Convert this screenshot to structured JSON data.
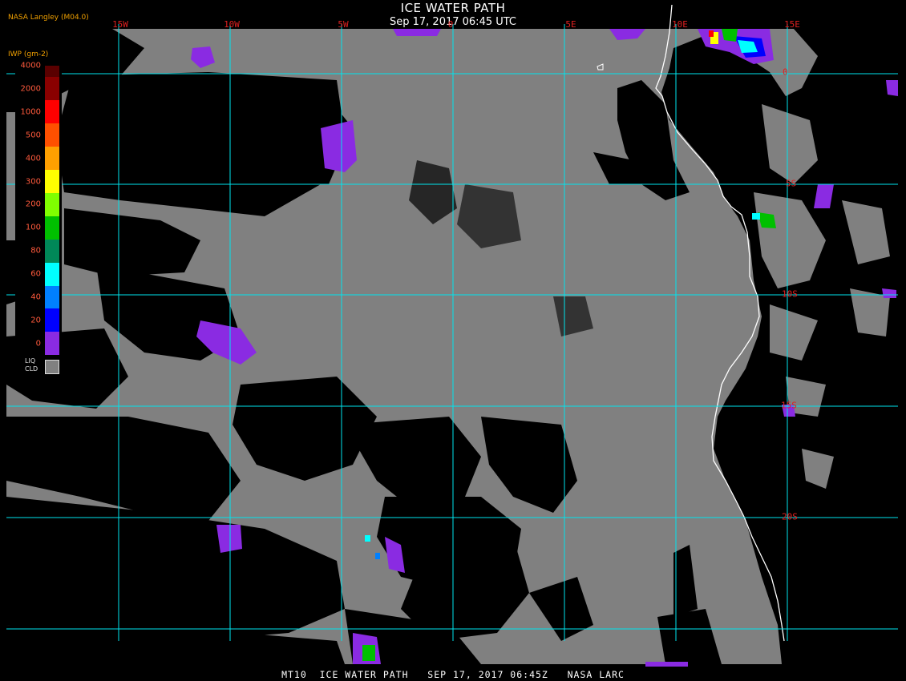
{
  "header": {
    "title": "ICE WATER PATH",
    "subtitle": "Sep 17, 2017 06:45 UTC",
    "brand": "NASA Langley (M04.0)"
  },
  "footer": {
    "text": "MT10  ICE WATER PATH   SEP 17, 2017 06:45Z   NASA LARC"
  },
  "grid": {
    "longitude_labels": [
      "15W",
      "10W",
      "5W",
      "0",
      "5E",
      "10E",
      "15E"
    ],
    "latitude_labels": [
      "0",
      "5S",
      "10S",
      "15S",
      "20S"
    ]
  },
  "legend": {
    "title": "IWP (gm-2)",
    "entries": [
      {
        "label": "4000",
        "color": "#5a0000"
      },
      {
        "label": "2000",
        "color": "#8a0000"
      },
      {
        "label": "1000",
        "color": "#ff0000"
      },
      {
        "label": "500",
        "color": "#ff5000"
      },
      {
        "label": "400",
        "color": "#ffa000"
      },
      {
        "label": "300",
        "color": "#ffff00"
      },
      {
        "label": "200",
        "color": "#80ff00"
      },
      {
        "label": "100",
        "color": "#00c000"
      },
      {
        "label": "80",
        "color": "#008858"
      },
      {
        "label": "60",
        "color": "#00ffff"
      },
      {
        "label": "40",
        "color": "#0080ff"
      },
      {
        "label": "20",
        "color": "#0000ff"
      },
      {
        "label": "0",
        "color": "#8a2be2"
      }
    ],
    "liquid_cloud_label": "LIQ\nCLD",
    "liquid_cloud_color": "#808080"
  },
  "colors": {
    "background": "#000000",
    "liquid_cloud": "#808080",
    "grid_lines": "#00e5ee",
    "coastline": "#ffffff",
    "grid_labels": "#e02020",
    "legend_title": "#f0a000"
  }
}
